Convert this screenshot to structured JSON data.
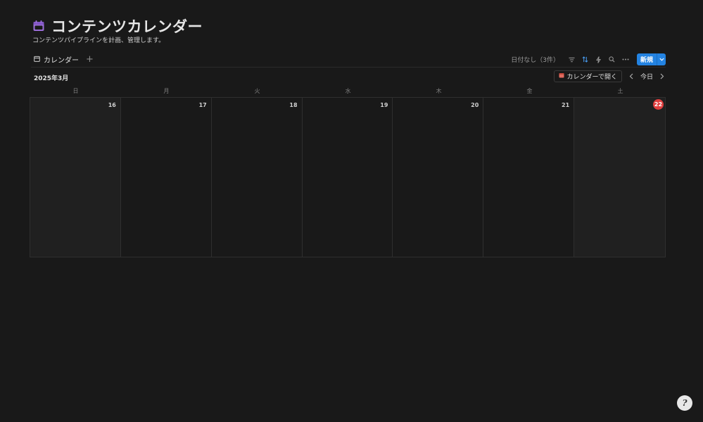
{
  "header": {
    "icon": "calendar-icon",
    "icon_color": "#9a6dd7",
    "title": "コンテンツカレンダー",
    "description": "コンテンツパイプラインを計画、管理します。"
  },
  "view_bar": {
    "tab_icon": "calendar-small-icon",
    "tab_label": "カレンダー",
    "add_label": "+",
    "no_date_label": "日付なし（3件）",
    "new_label": "新規",
    "accent": "#2383e2"
  },
  "calendar": {
    "month": "2025年3月",
    "open_label": "カレンダーで開く",
    "today_label": "今日",
    "weekdays": [
      "日",
      "月",
      "火",
      "水",
      "木",
      "金",
      "土"
    ],
    "days": [
      "16",
      "17",
      "18",
      "19",
      "20",
      "21",
      "22"
    ],
    "today_color": "#e03e3e"
  }
}
